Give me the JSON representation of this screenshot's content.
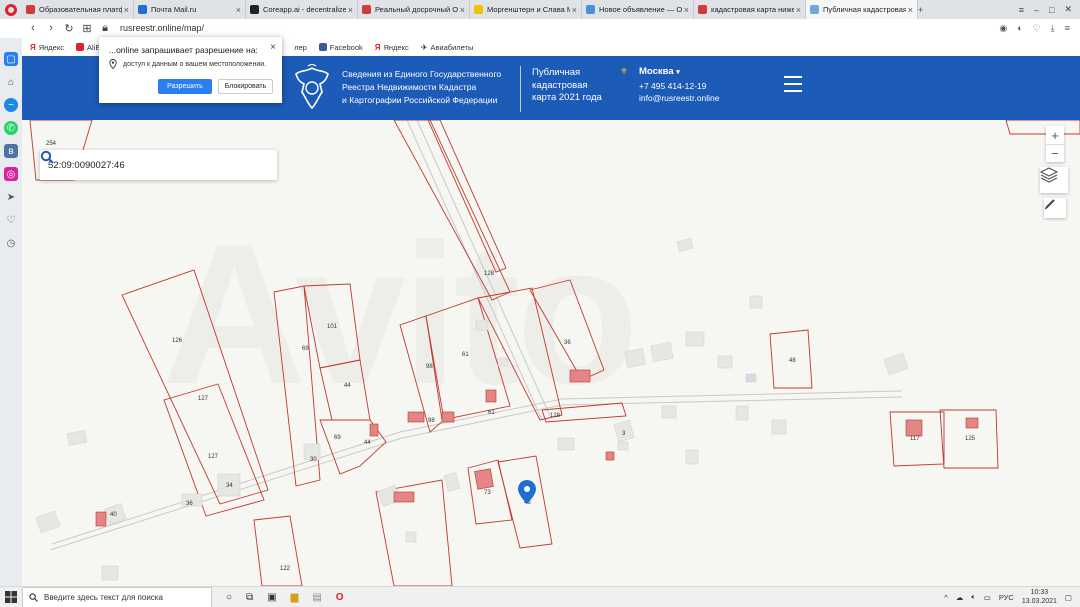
{
  "browser": {
    "tabs": [
      {
        "label": "Образовательная платфо",
        "color": "#d13b3b",
        "active": false
      },
      {
        "label": "Почта Mail.ru",
        "color": "#1f6fd1",
        "active": false
      },
      {
        "label": "Coreapp.ai - decentralized",
        "color": "#222222",
        "active": false
      },
      {
        "label": "Реальный досрочный ОГЭ",
        "color": "#d13b3b",
        "active": false
      },
      {
        "label": "Моргенштерн и Слава Ма",
        "color": "#f2c200",
        "active": false
      },
      {
        "label": "Новое объявление — Об",
        "color": "#4a90d9",
        "active": false
      },
      {
        "label": "кадастровая карта нижего",
        "color": "#d13b3b",
        "active": false
      },
      {
        "label": "Публичная кадастровая к",
        "color": "#6fa8dc",
        "active": true
      }
    ],
    "new_tab": "+",
    "url": "rusreestr.online/map/",
    "bookmarks": [
      {
        "label": "Яндекс",
        "color": "#e0212b",
        "glyph": "Я"
      },
      {
        "label": "AliEx",
        "color": "#e0212b",
        "glyph": "M"
      },
      {
        "label": "лер",
        "color": "#ffffff",
        "glyph": ""
      },
      {
        "label": "Facebook",
        "color": "#3b5998",
        "glyph": "f"
      },
      {
        "label": "Яндекс",
        "color": "#e0212b",
        "glyph": "Я"
      },
      {
        "label": "Авиабилеты",
        "color": "#f2c200",
        "glyph": "✈"
      }
    ]
  },
  "popup": {
    "title": "...online запрашивает разрешение на:",
    "permission": "доступ к данным о вашем местоположении.",
    "allow_label": "Разрешить",
    "block_label": "Блокировать",
    "close": "×"
  },
  "site": {
    "title_line1": "Сведения из Единого Государственного",
    "title_line2": "Реестра Недвижимости Кадастра",
    "title_line3": "и Картографии Российской Федерации",
    "map_line1": "Публичная",
    "map_line2": "кадастровая",
    "map_line3": "карта 2021 года",
    "city": "Москва",
    "phone": "+7 495 414-12-19",
    "email": "info@rusreestr.online"
  },
  "map": {
    "search_value": "52:09:0090027:46",
    "zoom_in": "+",
    "zoom_out": "−",
    "watermark": "Avito",
    "labels": {
      "l254": "254",
      "l126": "126",
      "l127a": "127",
      "l127b": "127",
      "l34": "34",
      "l36a": "36",
      "l40": "40",
      "l69a": "69",
      "l101": "101",
      "l44a": "44",
      "l44b": "44",
      "l69b": "69",
      "l30": "30",
      "l98a": "98",
      "l61a": "61",
      "l98b": "98",
      "l61b": "61",
      "l128a": "128",
      "l128b": "128",
      "l36b": "36",
      "l48": "48",
      "l3": "3",
      "l117": "117",
      "l125": "125",
      "l73": "73",
      "l46": "46",
      "l122": "122"
    }
  },
  "taskbar": {
    "search_placeholder": "Введите здесь текст для поиска",
    "lang": "РУС",
    "time": "10:33",
    "date": "13.03.2021"
  }
}
